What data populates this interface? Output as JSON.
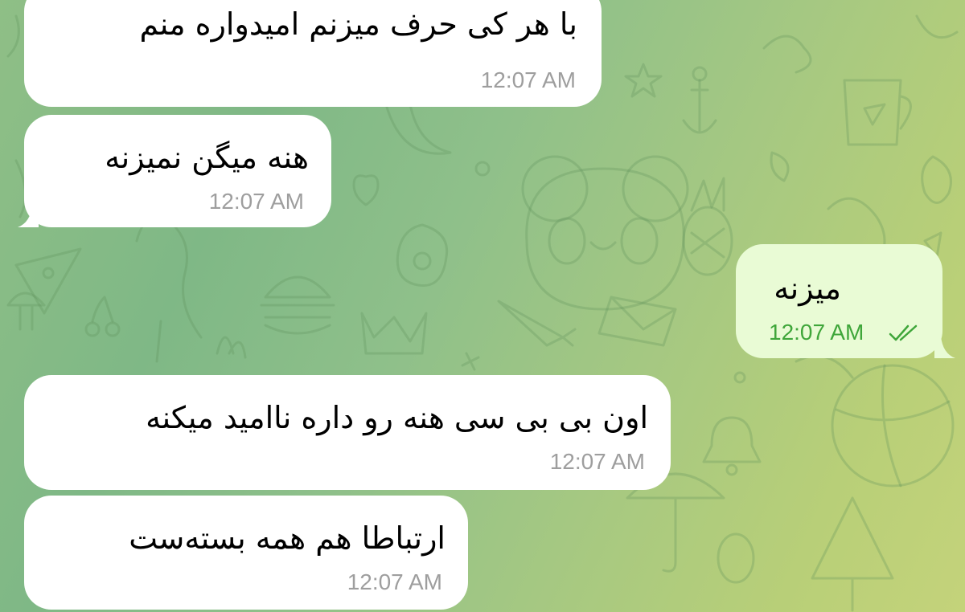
{
  "chat": {
    "colors": {
      "incoming_bubble": "#ffffff",
      "outgoing_bubble": "#e9fbd5",
      "incoming_time": "#9e9e9e",
      "outgoing_time": "#3fa63a",
      "read_check": "#3fa63a"
    },
    "messages": [
      {
        "direction": "incoming",
        "text": "با هر کی حرف میزنم امیدواره منم",
        "time": "12:07 AM"
      },
      {
        "direction": "incoming",
        "text": "هنه میگن نمیزنه",
        "time": "12:07 AM"
      },
      {
        "direction": "outgoing",
        "text": "میزنه",
        "time": "12:07 AM",
        "status_icon": "double-check-icon"
      },
      {
        "direction": "incoming",
        "text": "اون بی بی سی هنه رو داره ناامید میکنه",
        "time": "12:07 AM"
      },
      {
        "direction": "incoming",
        "text": "ارتباطا هم همه بسته‌ست",
        "time": "12:07 AM"
      }
    ]
  }
}
